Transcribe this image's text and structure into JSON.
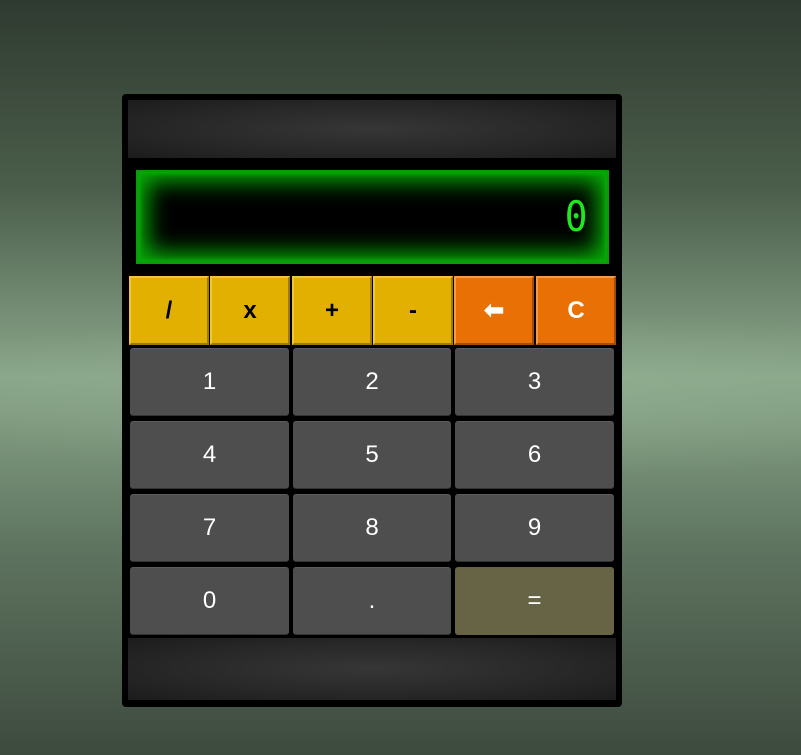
{
  "display": {
    "value": "0"
  },
  "operators": [
    {
      "label": "/",
      "name": "divide-button"
    },
    {
      "label": "x",
      "name": "multiply-button"
    },
    {
      "label": "+",
      "name": "add-button"
    },
    {
      "label": "-",
      "name": "subtract-button"
    }
  ],
  "controls": {
    "backspace_label": "⬅",
    "clear_label": "C"
  },
  "digits": {
    "d1": "1",
    "d2": "2",
    "d3": "3",
    "d4": "4",
    "d5": "5",
    "d6": "6",
    "d7": "7",
    "d8": "8",
    "d9": "9",
    "d0": "0"
  },
  "decimal_label": ".",
  "equals_label": "=",
  "colors": {
    "operator": "#e2b000",
    "control": "#e87005",
    "digit": "#4e4e4e",
    "equals": "#666444",
    "display_text": "#1ee81e",
    "display_glow": "#07a807"
  }
}
